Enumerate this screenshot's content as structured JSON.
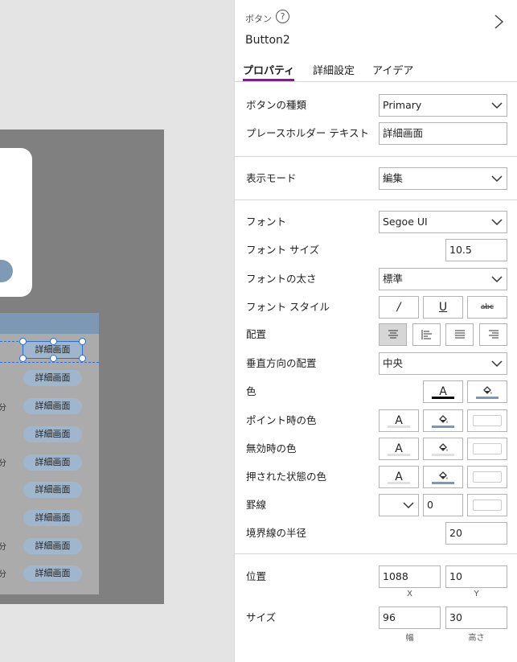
{
  "canvas": {
    "gallery_buttons": [
      "詳細画面",
      "詳細画面",
      "詳細画面",
      "詳細画面",
      "詳細画面",
      "詳細画面",
      "詳細画面",
      "詳細画面",
      "詳細画面"
    ],
    "gallery_minutes": [
      "分",
      "分",
      "分",
      "分"
    ]
  },
  "panel": {
    "control_type": "ボタン",
    "help_glyph": "?",
    "control_name": "Button2",
    "tabs": [
      "プロパティ",
      "詳細設定",
      "アイデア"
    ],
    "props": {
      "button_type_label": "ボタンの種類",
      "button_type_value": "Primary",
      "placeholder_label": "プレースホルダー テキスト",
      "placeholder_value": "詳細画面",
      "display_mode_label": "表示モード",
      "display_mode_value": "編集",
      "font_label": "フォント",
      "font_value": "Segoe UI",
      "font_size_label": "フォント サイズ",
      "font_size_value": "10.5",
      "font_weight_label": "フォントの太さ",
      "font_weight_value": "標準",
      "font_style_label": "フォント スタイル",
      "italic_glyph": "/",
      "underline_glyph": "U",
      "strike_glyph": "abc",
      "align_label": "配置",
      "valign_label": "垂直方向の配置",
      "valign_value": "中央",
      "color_label": "色",
      "hover_color_label": "ポイント時の色",
      "disabled_color_label": "無効時の色",
      "pressed_color_label": "押された状態の色",
      "text_glyph": "A",
      "border_label": "罫線",
      "border_value": "0",
      "radius_label": "境界線の半径",
      "radius_value": "20",
      "position_label": "位置",
      "x_value": "1088",
      "y_value": "10",
      "x_label": "X",
      "y_label": "Y",
      "size_label": "サイズ",
      "width_value": "96",
      "height_value": "30",
      "width_label": "幅",
      "height_label": "高さ"
    }
  },
  "colors": {
    "accent": "#742774",
    "fill_bar": "#7d98b4",
    "text_bar": "#000000"
  }
}
